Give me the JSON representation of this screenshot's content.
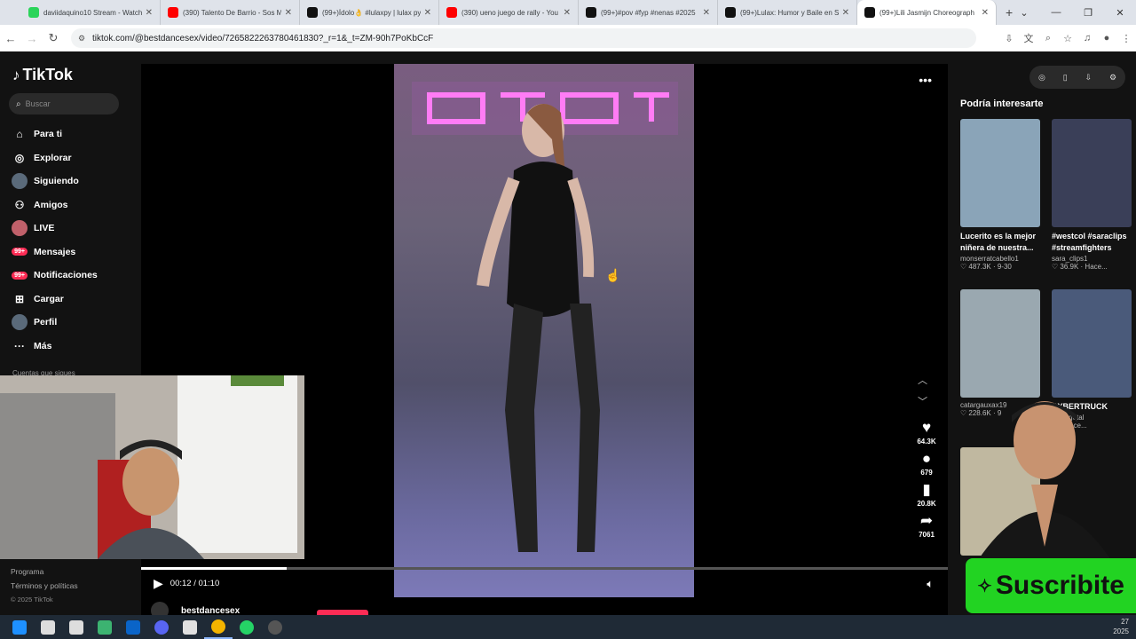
{
  "browser": {
    "tabs": [
      {
        "title": "daviidaquino10 Stream - Watch",
        "color": "#2bd45a"
      },
      {
        "title": "(390) Talento De Barrio - Sos M",
        "color": "#ff0000"
      },
      {
        "title": "(99+)Ídolo👌 #lulaxpy | lulax py",
        "color": "#111111"
      },
      {
        "title": "(390) ueno juego de rally - You",
        "color": "#ff0000"
      },
      {
        "title": "(99+)#pov #fyp #nenas #2025",
        "color": "#111111"
      },
      {
        "title": "(99+)Lulax: Humor y Baile en S",
        "color": "#111111"
      },
      {
        "title": "(99+)Lili Jasmijn Choreograph",
        "color": "#111111"
      }
    ],
    "url": "tiktok.com/@bestdancesex/video/7265822263780461830?_r=1&_t=ZM-90h7PoKbCcF"
  },
  "app": {
    "name": "TikTok"
  },
  "search": {
    "placeholder": "Buscar"
  },
  "nav": [
    {
      "label": "Para ti",
      "icon": "home-icon",
      "glyph": "⌂"
    },
    {
      "label": "Explorar",
      "icon": "compass-icon",
      "glyph": "◎"
    },
    {
      "label": "Siguiendo",
      "icon": "following-avatar-icon",
      "glyph": ""
    },
    {
      "label": "Amigos",
      "icon": "friends-icon",
      "glyph": "⚇"
    },
    {
      "label": "LIVE",
      "icon": "live-icon",
      "glyph": ""
    },
    {
      "label": "Mensajes",
      "icon": "messages-icon",
      "glyph": "",
      "badge": "99+"
    },
    {
      "label": "Notificaciones",
      "icon": "notifications-icon",
      "glyph": "",
      "badge": "99+"
    },
    {
      "label": "Cargar",
      "icon": "upload-icon",
      "glyph": "⊞"
    },
    {
      "label": "Perfil",
      "icon": "profile-icon",
      "glyph": ""
    },
    {
      "label": "Más",
      "icon": "more-icon",
      "glyph": "···"
    }
  ],
  "sidebar": {
    "following_header": "Cuentas que sigues",
    "footer": [
      "Programa",
      "Términos y políticas"
    ],
    "copyright": "© 2025 TikTok"
  },
  "player": {
    "time": "00:12 / 01:10",
    "progress": 0.18,
    "likes": "64.3K",
    "comments": "679",
    "saves": "20.8K",
    "shares": "7061"
  },
  "channel": {
    "name": "bestdancesex"
  },
  "recommendations": {
    "title": "Podría interesarte",
    "cards": [
      {
        "title": "Lucerito es la mejor niñera de nuestra...",
        "author": "monserratcabello1",
        "meta": "♡ 487.3K · 9-30",
        "thumb": "#8aa4b8"
      },
      {
        "title": "#westcol #saraclips #streamfighters",
        "author": "sara_clips1",
        "meta": "♡ 36.9K · Hace...",
        "thumb": "#3a3f58"
      },
      {
        "title": "",
        "author": "catargauxax19",
        "meta": "♡ 228.6K · 9",
        "thumb": "#9aa8b0"
      },
      {
        "title": "CYBERTRUCK",
        "author": "oalvegetal",
        "meta": "♡ · Hace...",
        "thumb": "#4a5a7a"
      },
      {
        "title": "",
        "author": "",
        "meta": "",
        "thumb": "#c0b8a0"
      }
    ]
  },
  "overlay": {
    "subscribe_label": "Suscribite"
  },
  "taskbar": {
    "clock_day": "27",
    "clock_year": "2025",
    "apps": [
      {
        "icon": "windows-start-icon",
        "color": "#1e90ff"
      },
      {
        "icon": "search-icon",
        "color": "#dddddd"
      },
      {
        "icon": "task-view-icon",
        "color": "#dddddd"
      },
      {
        "icon": "app-green-icon",
        "color": "#3cb371"
      },
      {
        "icon": "outlook-icon",
        "color": "#0a64c8"
      },
      {
        "icon": "discord-icon",
        "color": "#5865f2"
      },
      {
        "icon": "app-tile-icon",
        "color": "#e0e0e0"
      },
      {
        "icon": "chrome-icon",
        "color": "#f4b400"
      },
      {
        "icon": "whatsapp-icon",
        "color": "#25d366"
      },
      {
        "icon": "obs-icon",
        "color": "#555555"
      }
    ]
  }
}
